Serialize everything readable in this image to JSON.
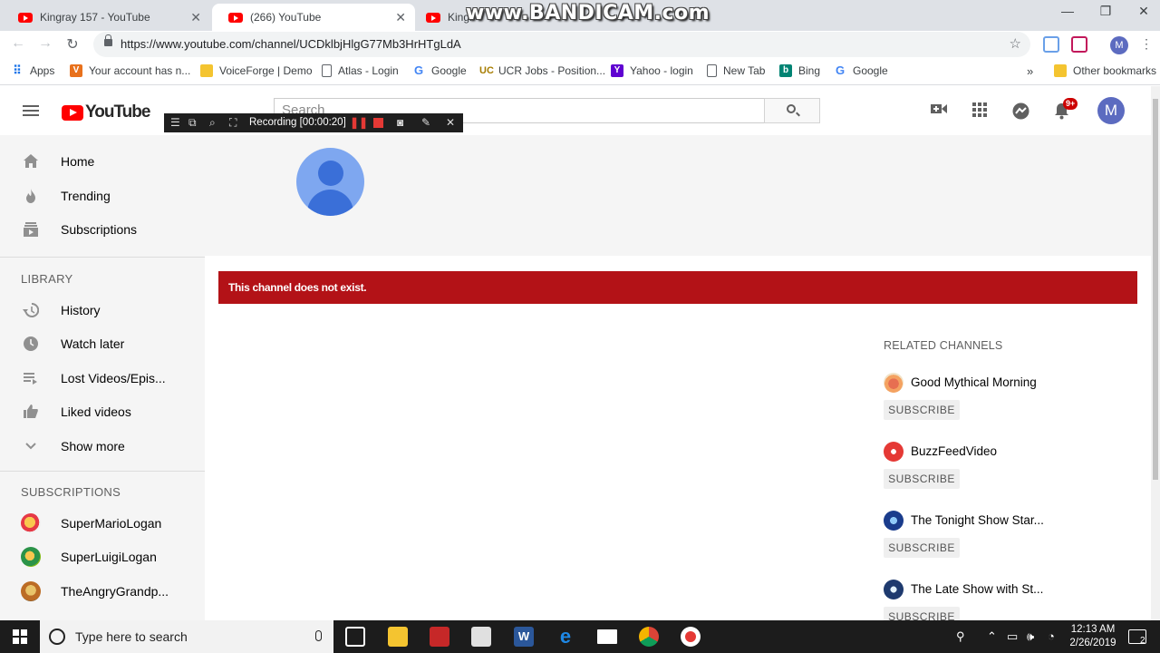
{
  "browser": {
    "tabs": [
      {
        "title": "Kingray 157 - YouTube"
      },
      {
        "title": "(266) YouTube"
      },
      {
        "title": "Kingr"
      }
    ],
    "url": "https://www.youtube.com/channel/UCDklbjHlgG77Mb3HrHTgLdA",
    "bookmarks": [
      {
        "label": "Apps",
        "icon": "apps-grid-icon"
      },
      {
        "label": "Your account has n...",
        "icon": "v-logo-icon"
      },
      {
        "label": "VoiceForge | Demo",
        "icon": "voiceforge-icon"
      },
      {
        "label": "Atlas - Login",
        "icon": "page-icon"
      },
      {
        "label": "Google",
        "icon": "google-icon"
      },
      {
        "label": "UCR Jobs - Position...",
        "icon": "ucr-icon"
      },
      {
        "label": "Yahoo - login",
        "icon": "yahoo-icon"
      },
      {
        "label": "New Tab",
        "icon": "page-icon"
      },
      {
        "label": "Bing",
        "icon": "bing-icon"
      },
      {
        "label": "Google",
        "icon": "google-icon"
      }
    ],
    "bookmarks_overflow": "»",
    "other_bookmarks": "Other bookmarks",
    "profile_initial": "M"
  },
  "watermark": "www.BANDICAM.com",
  "recorder": {
    "status": "Recording [00:00:20]"
  },
  "youtube": {
    "logo_text": "YouTube",
    "search_placeholder": "Search",
    "notification_count": "9+",
    "avatar_initial": "M",
    "colors": {
      "brand": "#ff0000",
      "error": "#b31217",
      "avatar": "#5c6bc0"
    }
  },
  "sidebar": {
    "main_items": [
      {
        "label": "Home",
        "icon": "home-icon"
      },
      {
        "label": "Trending",
        "icon": "flame-icon"
      },
      {
        "label": "Subscriptions",
        "icon": "subscriptions-icon"
      }
    ],
    "library_heading": "LIBRARY",
    "library_items": [
      {
        "label": "History",
        "icon": "history-icon"
      },
      {
        "label": "Watch later",
        "icon": "clock-icon"
      },
      {
        "label": "Lost Videos/Epis...",
        "icon": "playlist-icon"
      },
      {
        "label": "Liked videos",
        "icon": "thumbs-up-icon"
      },
      {
        "label": "Show more",
        "icon": "chevron-down-icon"
      }
    ],
    "subscriptions_heading": "SUBSCRIPTIONS",
    "subscriptions": [
      {
        "label": "SuperMarioLogan"
      },
      {
        "label": "SuperLuigiLogan"
      },
      {
        "label": "TheAngryGrandp..."
      }
    ]
  },
  "channel": {
    "error_message": "This channel does not exist.",
    "related_heading": "RELATED CHANNELS",
    "related": [
      {
        "name": "Good Mythical Morning",
        "button": "SUBSCRIBE"
      },
      {
        "name": "BuzzFeedVideo",
        "button": "SUBSCRIBE"
      },
      {
        "name": "The Tonight Show Star...",
        "button": "SUBSCRIBE"
      },
      {
        "name": "The Late Show with St...",
        "button": "SUBSCRIBE"
      }
    ]
  },
  "taskbar": {
    "search_placeholder": "Type here to search",
    "time": "12:13 AM",
    "date": "2/26/2019",
    "notification_count": "2"
  }
}
